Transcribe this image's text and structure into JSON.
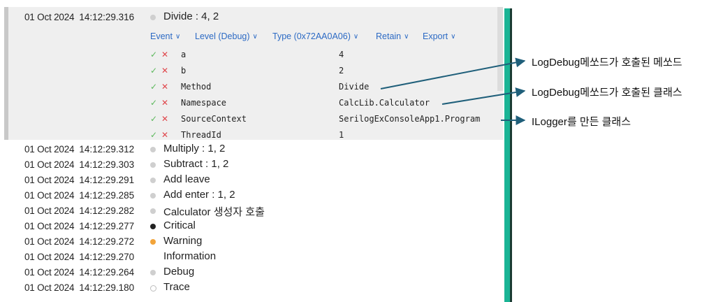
{
  "expanded_event": {
    "date": "01 Oct 2024",
    "time": "14:12:29.316",
    "message": "Divide : 4, 2",
    "menus": [
      {
        "label": "Event"
      },
      {
        "label": "Level (Debug)"
      },
      {
        "label": "Type (0x72AA0A06)"
      },
      {
        "label": "Retain"
      },
      {
        "label": "Export"
      }
    ],
    "properties": [
      {
        "key": "a",
        "value": "4"
      },
      {
        "key": "b",
        "value": "2"
      },
      {
        "key": "Method",
        "value": "Divide"
      },
      {
        "key": "Namespace",
        "value": "CalcLib.Calculator"
      },
      {
        "key": "SourceContext",
        "value": "SerilogExConsoleApp1.Program"
      },
      {
        "key": "ThreadId",
        "value": "1"
      }
    ]
  },
  "events": [
    {
      "date": "01 Oct 2024",
      "time": "14:12:29.312",
      "message": "Multiply : 1, 2",
      "level_dot": "gray"
    },
    {
      "date": "01 Oct 2024",
      "time": "14:12:29.303",
      "message": "Subtract : 1, 2",
      "level_dot": "gray"
    },
    {
      "date": "01 Oct 2024",
      "time": "14:12:29.291",
      "message": "Add leave",
      "level_dot": "gray"
    },
    {
      "date": "01 Oct 2024",
      "time": "14:12:29.285",
      "message": "Add enter : 1, 2",
      "level_dot": "gray"
    },
    {
      "date": "01 Oct 2024",
      "time": "14:12:29.282",
      "message": "Calculator 생성자 호출",
      "level_dot": "gray"
    },
    {
      "date": "01 Oct 2024",
      "time": "14:12:29.277",
      "message": "Critical",
      "level_dot": "black"
    },
    {
      "date": "01 Oct 2024",
      "time": "14:12:29.272",
      "message": "Warning",
      "level_dot": "orange"
    },
    {
      "date": "01 Oct 2024",
      "time": "14:12:29.270",
      "message": "Information",
      "level_dot": "none"
    },
    {
      "date": "01 Oct 2024",
      "time": "14:12:29.264",
      "message": "Debug",
      "level_dot": "gray"
    },
    {
      "date": "01 Oct 2024",
      "time": "14:12:29.180",
      "message": "Trace",
      "level_dot": "hollow"
    }
  ],
  "annotations": [
    {
      "text": "LogDebug메쏘드가 호출된 메쏘드"
    },
    {
      "text": "LogDebug메쏘드가 호출된 클래스"
    },
    {
      "text": "ILogger를 만든 클래스"
    }
  ],
  "icons": {
    "include": "check-icon",
    "exclude": "x-icon",
    "dropdown": "chevron-down-icon"
  },
  "colors": {
    "accent_teal": "#1ab495",
    "link_blue": "#2c6ac4",
    "check_green": "#5cb85c",
    "exclude_red": "#e0474c",
    "warning_orange": "#f2a43a",
    "annotation_arrow": "#1f5f7a"
  }
}
